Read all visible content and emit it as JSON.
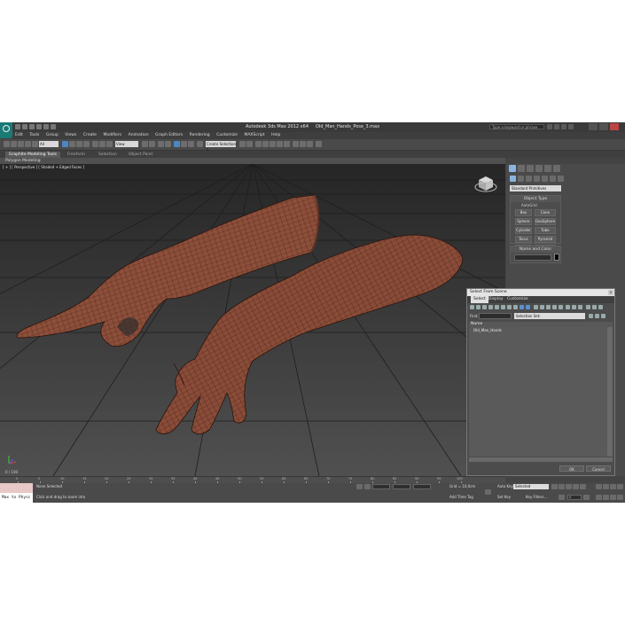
{
  "window": {
    "app_title": "Autodesk 3ds Max 2012 x64",
    "file_name": "Old_Man_Hands_Pose_3.max",
    "search_placeholder": "Type a keyword or phrase"
  },
  "menubar": [
    "Edit",
    "Tools",
    "Group",
    "Views",
    "Create",
    "Modifiers",
    "Animation",
    "Graph Editors",
    "Rendering",
    "Customize",
    "MAXScript",
    "Help"
  ],
  "toolbar": {
    "filter_value": "All",
    "reference_coord": "View",
    "selection_set": "Create Selection S"
  },
  "ribbon": {
    "tabs": [
      "Graphite Modeling Tools",
      "Freeform",
      "Selection",
      "Object Paint"
    ],
    "active_tab": "Graphite Modeling Tools",
    "panel_label": "Polygon Modeling"
  },
  "viewport": {
    "label": "[ + ] [ Perspective ] [ Shaded + Edged Faces ]",
    "frame_counter": "0 / 100"
  },
  "command_panel": {
    "category_dropdown": "Standard Primitives",
    "object_type": {
      "header": "Object Type",
      "autogrid_label": "AutoGrid",
      "buttons": [
        "Box",
        "Cone",
        "Sphere",
        "GeoSphere",
        "Cylinder",
        "Tube",
        "Torus",
        "Pyramid",
        "Teapot",
        "Plane"
      ]
    },
    "name_and_color": {
      "header": "Name and Color",
      "swatch_color": "#000000"
    }
  },
  "dialog": {
    "title": "Select From Scene",
    "close_glyph": "x",
    "menu": [
      "Select",
      "Display",
      "Customize"
    ],
    "active_menu": "Select",
    "find_label": "Find:",
    "selection_set_label": "Selection Set:",
    "column_header": "Name",
    "items": [
      "Old_Man_Hands"
    ],
    "ok_label": "OK",
    "cancel_label": "Cancel"
  },
  "timeline": {
    "ticks": [
      "0",
      "5",
      "10",
      "15",
      "20",
      "25",
      "30",
      "35",
      "40",
      "45",
      "50",
      "55",
      "60",
      "65",
      "70",
      "75",
      "80",
      "85",
      "90",
      "95",
      "100"
    ]
  },
  "statusbar": {
    "maxscript_text": "Max to Physc",
    "status_line1": "None Selected",
    "status_line2": "Click and drag to zoom into",
    "grid_text": "Grid = 10,0cm",
    "add_time_tag": "Add Time Tag",
    "auto_key": "Auto Key",
    "auto_key_selected": "Selected",
    "set_key": "Set Key",
    "key_filters": "Key Filters...",
    "frame_value": "0"
  },
  "colors": {
    "app_bg": "#444444",
    "viewport_bg_top": "#2a2a2a",
    "viewport_bg_bottom": "#4d4d4d",
    "skin": "#8a4d38",
    "wire": "#3a1d14",
    "selection_blue": "#4d86c2"
  }
}
